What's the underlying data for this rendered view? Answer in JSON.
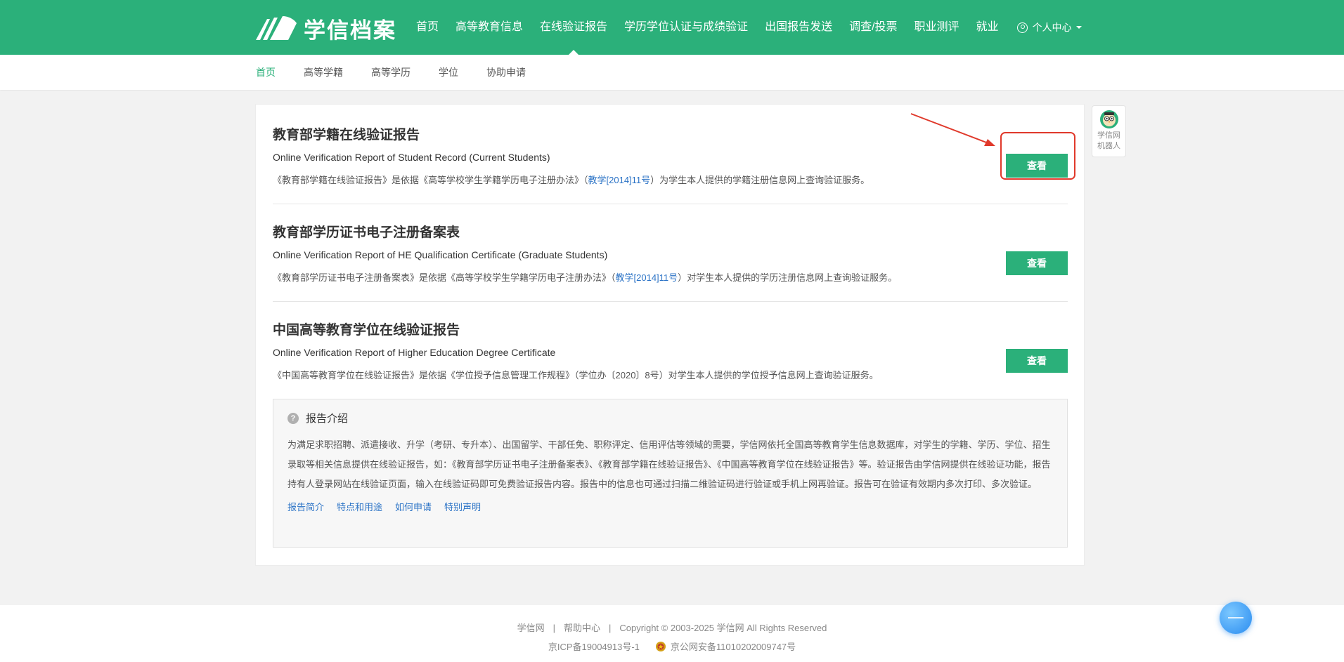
{
  "header": {
    "logo_text": "学信档案",
    "nav": [
      {
        "label": "首页"
      },
      {
        "label": "高等教育信息"
      },
      {
        "label": "在线验证报告"
      },
      {
        "label": "学历学位认证与成绩验证"
      },
      {
        "label": "出国报告发送"
      },
      {
        "label": "调查/投票"
      },
      {
        "label": "职业测评"
      },
      {
        "label": "就业"
      }
    ],
    "active_nav": "在线验证报告",
    "user_menu_label": "个人中心"
  },
  "subnav": {
    "items": [
      {
        "label": "首页"
      },
      {
        "label": "高等学籍"
      },
      {
        "label": "高等学历"
      },
      {
        "label": "学位"
      },
      {
        "label": "协助申请"
      }
    ],
    "active": "首页"
  },
  "reports": [
    {
      "title": "教育部学籍在线验证报告",
      "subtitle": "Online Verification Report of Student Record (Current Students)",
      "desc_before": "《教育部学籍在线验证报告》是依据《高等学校学生学籍学历电子注册办法》（",
      "desc_link": "教学[2014]11号",
      "desc_after": "）为学生本人提供的学籍注册信息网上查询验证服务。",
      "button_label": "查看"
    },
    {
      "title": "教育部学历证书电子注册备案表",
      "subtitle": "Online Verification Report of HE Qualification Certificate (Graduate Students)",
      "desc_before": "《教育部学历证书电子注册备案表》是依据《高等学校学生学籍学历电子注册办法》（",
      "desc_link": "教学[2014]11号",
      "desc_after": "）对学生本人提供的学历注册信息网上查询验证服务。",
      "button_label": "查看"
    },
    {
      "title": "中国高等教育学位在线验证报告",
      "subtitle": "Online Verification Report of Higher Education Degree Certificate",
      "desc_before": "《中国高等教育学位在线验证报告》是依据《学位授予信息管理工作规程》（学位办〔2020〕8号）对学生本人提供的学位授予信息网上查询验证服务。",
      "desc_link": "",
      "desc_after": "",
      "button_label": "查看"
    }
  ],
  "intro": {
    "title": "报告介绍",
    "body": "为满足求职招聘、派遣接收、升学（考研、专升本）、出国留学、干部任免、职称评定、信用评估等领域的需要，学信网依托全国高等教育学生信息数据库，对学生的学籍、学历、学位、招生录取等相关信息提供在线验证报告，如：《教育部学历证书电子注册备案表》、《教育部学籍在线验证报告》、《中国高等教育学位在线验证报告》等。验证报告由学信网提供在线验证功能，报告持有人登录网站在线验证页面，输入在线验证码即可免费验证报告内容。报告中的信息也可通过扫描二维验证码进行验证或手机上网再验证。报告可在验证有效期内多次打印、多次验证。",
    "links": [
      {
        "label": "报告简介"
      },
      {
        "label": "特点和用途"
      },
      {
        "label": "如何申请"
      },
      {
        "label": "特别声明"
      }
    ]
  },
  "robot": {
    "label_line1": "学信网",
    "label_line2": "机器人"
  },
  "footer": {
    "link1": "学信网",
    "link2": "帮助中心",
    "copyright": "Copyright © 2003-2025 学信网 All Rights Reserved",
    "icp": "京ICP备19004913号-1",
    "police": "京公网安备11010202009747号"
  },
  "colors": {
    "brand_green": "#2bb07a",
    "link_blue": "#2b73c6",
    "annotation_red": "#e0392b"
  },
  "icons": {
    "logo": "book-pages-logo-icon",
    "user": "user-circle-icon",
    "dropdown": "caret-down-icon",
    "help": "question-circle-icon",
    "robot": "robot-owl-icon",
    "police": "police-badge-icon",
    "float": "chat-bubble-icon"
  }
}
